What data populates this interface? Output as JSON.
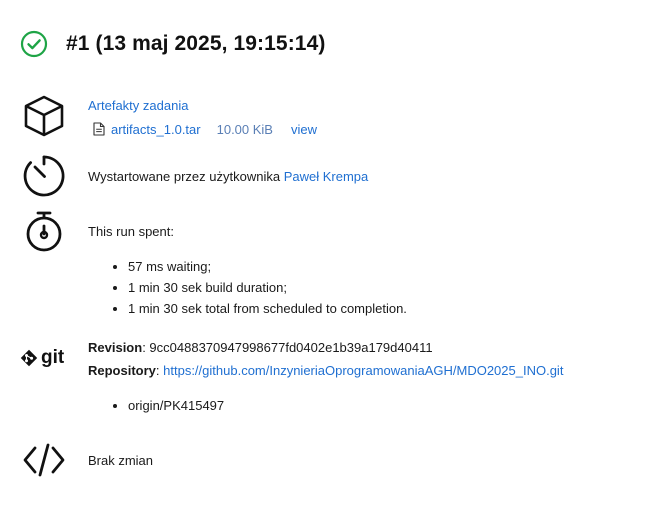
{
  "header": {
    "title": "#1 (13 maj 2025, 19:15:14)",
    "status_icon": "check-circle-icon",
    "status_color": "#1ea446"
  },
  "artifacts": {
    "icon": "box-icon",
    "heading": "Artefakty zadania",
    "file": {
      "icon": "document-icon",
      "name": "artifacts_1.0.tar",
      "size": "10.00 KiB",
      "view_label": "view"
    }
  },
  "started_by": {
    "icon": "timer-icon",
    "text": "Wystartowane przez użytkownika",
    "user": "Paweł Krempa"
  },
  "timing": {
    "icon": "stopwatch-icon",
    "heading": "This run spent:",
    "items": [
      "57 ms waiting;",
      "1 min 30 sek build duration;",
      "1 min 30 sek total from scheduled to completion."
    ]
  },
  "git": {
    "icon": "git-logo-icon",
    "logo_text": "git",
    "revision_label": "Revision",
    "revision_value": "9cc0488370947998677fd0402e1b39a179d40411",
    "repository_label": "Repository",
    "repository_url": "https://github.com/InzynieriaOprogramowaniaAGH/MDO2025_INO.git",
    "branches": [
      "origin/PK415497"
    ]
  },
  "changes": {
    "icon": "code-icon",
    "text": "Brak zmian"
  },
  "colors": {
    "link": "#1f6fd1",
    "success": "#1ea446"
  }
}
